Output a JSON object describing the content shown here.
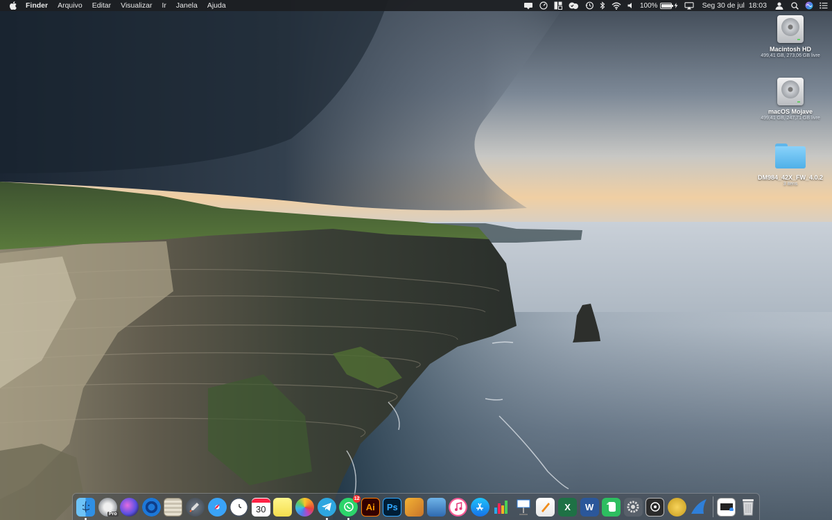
{
  "menubar": {
    "app_name": "Finder",
    "menus": [
      "Arquivo",
      "Editar",
      "Visualizar",
      "Ir",
      "Janela",
      "Ajuda"
    ],
    "battery_percent": "100%",
    "battery_level": 1.0,
    "clock": "Seg 30 de jul  18:03"
  },
  "desktop": {
    "icons": [
      {
        "title": "Macintosh HD",
        "subtitle": "499,41 GB, 273,06 GB livre",
        "icon": "hard-drive-icon"
      },
      {
        "title": "macOS Mojave",
        "subtitle": "499,41 GB, 247,71 GB livre",
        "icon": "hard-drive-icon"
      },
      {
        "title": "DM984_42X_FW_4.0.2",
        "subtitle": "3 itens",
        "icon": "folder-icon"
      }
    ]
  },
  "dock": {
    "items": [
      {
        "name": "finder",
        "running": true
      },
      {
        "name": "disk-utility",
        "label": "Pro",
        "running": false
      },
      {
        "name": "siri",
        "running": false
      },
      {
        "name": "airdrop",
        "running": false
      },
      {
        "name": "notes-pad",
        "running": false
      },
      {
        "name": "launchpad",
        "running": false
      },
      {
        "name": "safari",
        "running": false
      },
      {
        "name": "clock",
        "running": false
      },
      {
        "name": "calendar",
        "label": "30",
        "running": false
      },
      {
        "name": "stickies",
        "running": false
      },
      {
        "name": "photos",
        "running": false
      },
      {
        "name": "telegram",
        "running": true
      },
      {
        "name": "whatsapp",
        "badge": "12",
        "running": true
      },
      {
        "name": "illustrator",
        "label": "Ai",
        "running": false
      },
      {
        "name": "photoshop",
        "label": "Ps",
        "running": false
      },
      {
        "name": "sketch-book",
        "running": false
      },
      {
        "name": "migration-assistant",
        "running": false
      },
      {
        "name": "itunes",
        "running": false
      },
      {
        "name": "app-store",
        "running": false
      },
      {
        "name": "numbers",
        "running": false
      },
      {
        "name": "keynote",
        "running": false
      },
      {
        "name": "pages",
        "running": false
      },
      {
        "name": "excel",
        "label": "X",
        "running": false
      },
      {
        "name": "word",
        "label": "W",
        "running": false
      },
      {
        "name": "evernote",
        "running": false
      },
      {
        "name": "system-preferences",
        "running": false
      },
      {
        "name": "scanner",
        "running": false
      },
      {
        "name": "font-app",
        "running": false
      },
      {
        "name": "sharkfin",
        "running": false
      }
    ],
    "right_items": [
      {
        "name": "downloads-stack"
      },
      {
        "name": "trash"
      }
    ]
  }
}
